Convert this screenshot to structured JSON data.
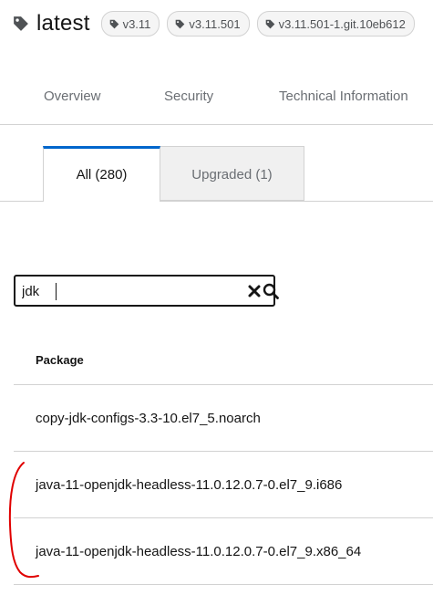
{
  "header": {
    "title": "latest",
    "labels": [
      "v3.11",
      "v3.11.501",
      "v3.11.501-1.git.10eb612"
    ]
  },
  "tabs": [
    {
      "label": "Overview"
    },
    {
      "label": "Security"
    },
    {
      "label": "Technical Information"
    }
  ],
  "subtabs": [
    {
      "label": "All (280)",
      "active": true
    },
    {
      "label": "Upgraded (1)",
      "active": false
    }
  ],
  "search": {
    "value": "jdk"
  },
  "table": {
    "header": "Package",
    "rows": [
      "copy-jdk-configs-3.3-10.el7_5.noarch",
      "java-11-openjdk-headless-11.0.12.0.7-0.el7_9.i686",
      "java-11-openjdk-headless-11.0.12.0.7-0.el7_9.x86_64"
    ]
  },
  "colors": {
    "active_tab_border": "#0066cc",
    "annotation": "#e00000"
  },
  "icons": [
    "tag-icon",
    "close-icon",
    "search-icon"
  ]
}
